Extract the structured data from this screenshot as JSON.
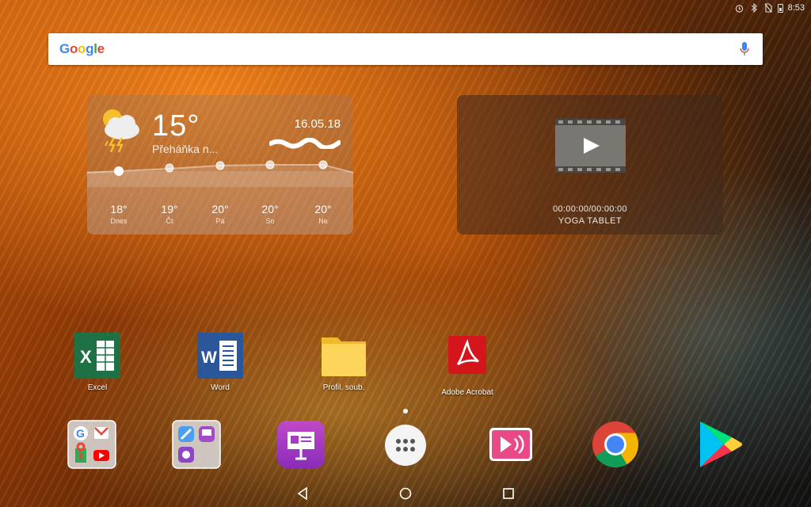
{
  "status_bar": {
    "time": "8:53",
    "icons": [
      "alarm-icon",
      "bluetooth-icon",
      "no-sim-icon",
      "battery-icon"
    ]
  },
  "search": {
    "logo_letters": [
      "G",
      "o",
      "o",
      "g",
      "l",
      "e"
    ],
    "placeholder": "",
    "icon": "mic-icon"
  },
  "weather": {
    "temperature": "15°",
    "condition": "Přeháňka n...",
    "date": "16.05.18",
    "forecast": [
      {
        "temp": "18°",
        "day": "Dnes"
      },
      {
        "temp": "19°",
        "day": "Čt"
      },
      {
        "temp": "20°",
        "day": "Pá"
      },
      {
        "temp": "20°",
        "day": "So"
      },
      {
        "temp": "20°",
        "day": "Ne"
      }
    ]
  },
  "video": {
    "time": "00:00:00/00:00:00",
    "label": "YOGA TABLET"
  },
  "apps": [
    {
      "label": "Excel",
      "icon": "excel-icon",
      "color": "#1e7145"
    },
    {
      "label": "Word",
      "icon": "word-icon",
      "color": "#2b579a"
    },
    {
      "label": "Profil. soub.",
      "icon": "folder-icon",
      "color": "#fdd55a"
    },
    {
      "label": "Adobe Acrobat",
      "icon": "acrobat-icon",
      "color": "#d4161c"
    }
  ],
  "dock": [
    {
      "name": "google-apps-folder"
    },
    {
      "name": "tools-folder"
    },
    {
      "name": "presentation-app"
    },
    {
      "name": "app-drawer"
    },
    {
      "name": "media-app"
    },
    {
      "name": "chrome-app"
    },
    {
      "name": "play-store-app"
    }
  ],
  "nav": [
    "back-icon",
    "home-icon",
    "recents-icon"
  ]
}
